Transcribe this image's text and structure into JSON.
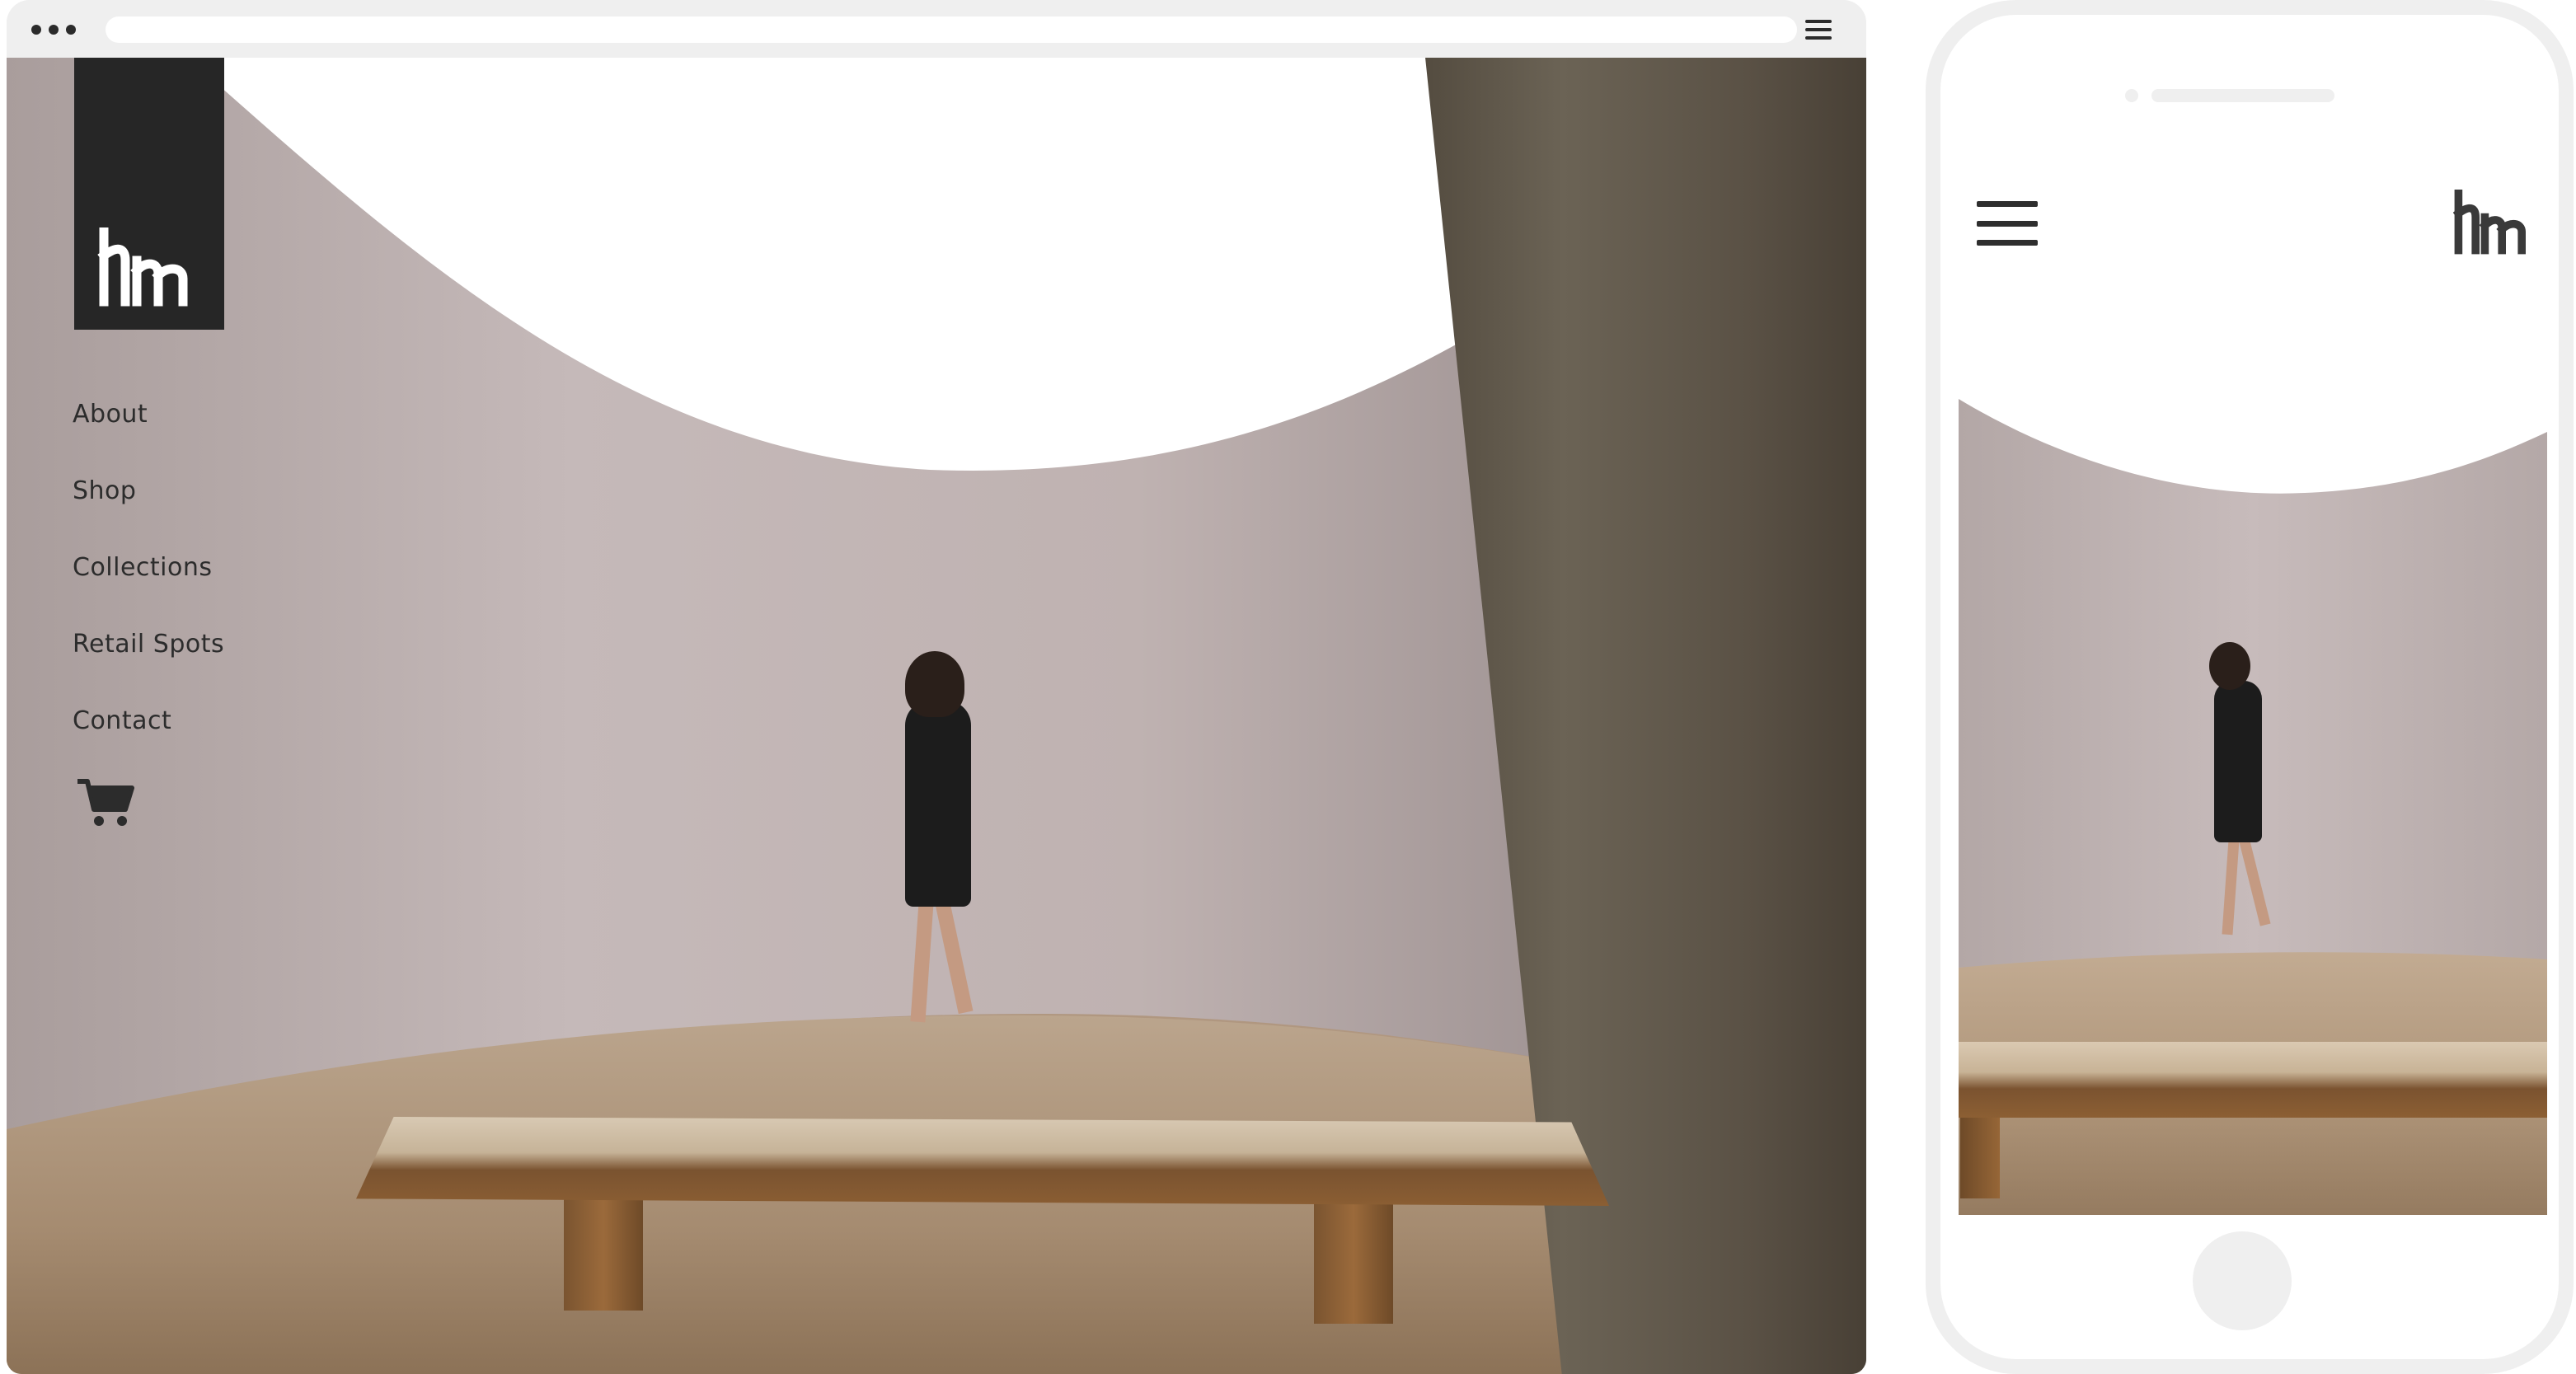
{
  "desktop": {
    "brand": "hm",
    "nav": [
      {
        "label": "About"
      },
      {
        "label": "Shop"
      },
      {
        "label": "Collections"
      },
      {
        "label": "Retail Spots"
      },
      {
        "label": "Contact"
      }
    ],
    "icons": {
      "window_controls": "dots-icon",
      "browser_menu": "hamburger-icon",
      "cart": "cart-icon",
      "logo": "logo-mark"
    }
  },
  "mobile": {
    "brand": "hm",
    "icons": {
      "menu": "hamburger-icon",
      "logo": "logo-mark"
    }
  },
  "colors": {
    "logo_background": "#262626",
    "nav_text": "#2c2c2c",
    "frame": "#efefef"
  }
}
